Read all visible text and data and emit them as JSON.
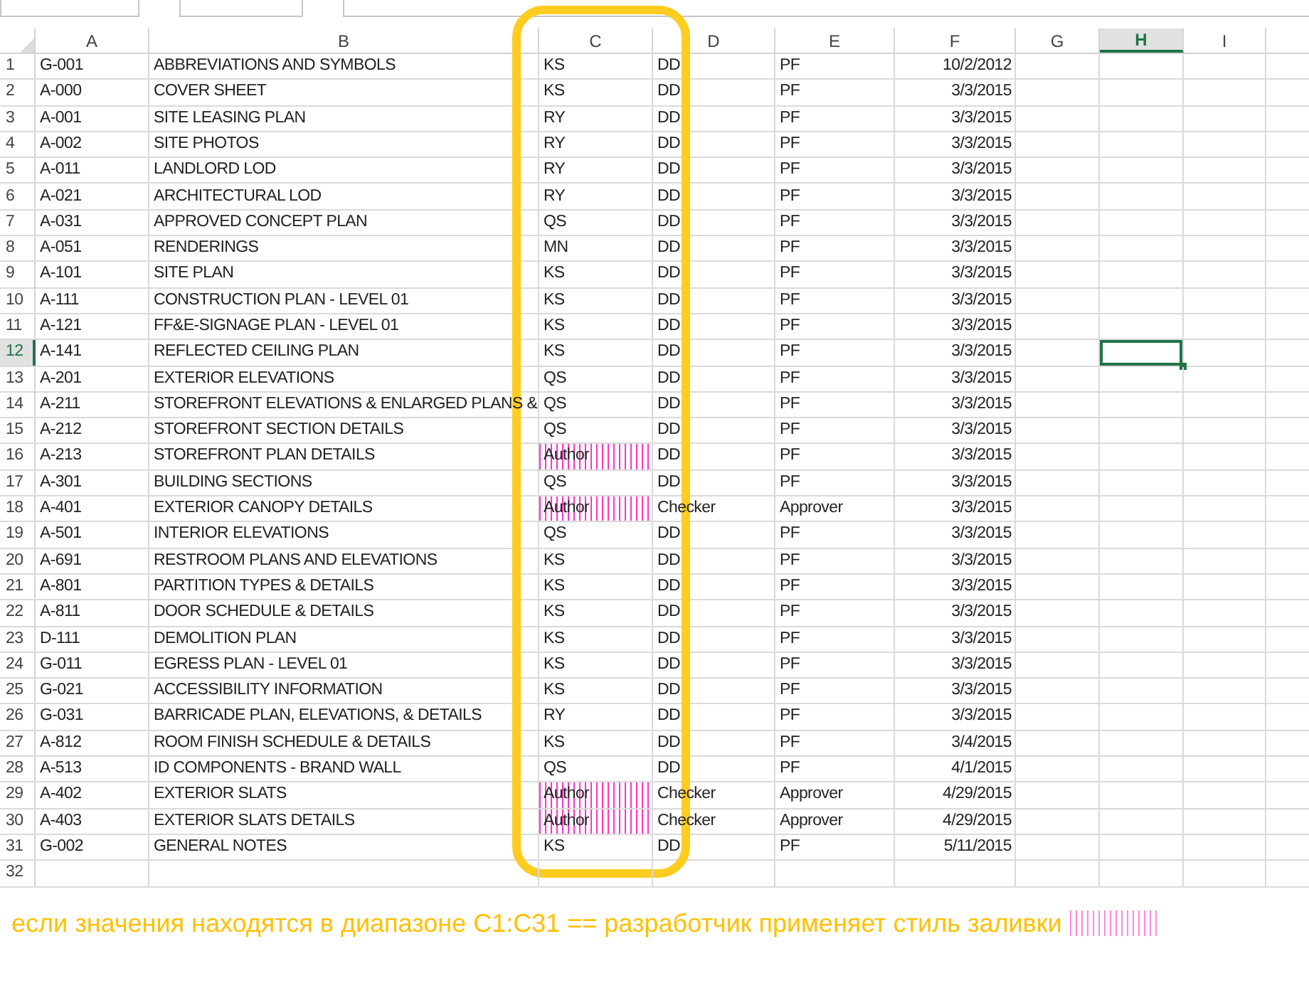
{
  "columns": [
    {
      "label": "A",
      "selected": false
    },
    {
      "label": "B",
      "selected": false
    },
    {
      "label": "C",
      "selected": false
    },
    {
      "label": "D",
      "selected": false
    },
    {
      "label": "E",
      "selected": false
    },
    {
      "label": "F",
      "selected": false
    },
    {
      "label": "G",
      "selected": false
    },
    {
      "label": "H",
      "selected": true
    },
    {
      "label": "I",
      "selected": false
    }
  ],
  "rows": [
    {
      "num": "1",
      "selected": false,
      "hatched": false,
      "cells": [
        "G-001",
        "ABBREVIATIONS AND SYMBOLS",
        "KS",
        "DD",
        "PF",
        "10/2/2012"
      ]
    },
    {
      "num": "2",
      "selected": false,
      "hatched": false,
      "cells": [
        "A-000",
        "COVER SHEET",
        "KS",
        "DD",
        "PF",
        "3/3/2015"
      ]
    },
    {
      "num": "3",
      "selected": false,
      "hatched": false,
      "cells": [
        "A-001",
        "SITE LEASING PLAN",
        "RY",
        "DD",
        "PF",
        "3/3/2015"
      ]
    },
    {
      "num": "4",
      "selected": false,
      "hatched": false,
      "cells": [
        "A-002",
        "SITE PHOTOS",
        "RY",
        "DD",
        "PF",
        "3/3/2015"
      ]
    },
    {
      "num": "5",
      "selected": false,
      "hatched": false,
      "cells": [
        "A-011",
        "LANDLORD LOD",
        "RY",
        "DD",
        "PF",
        "3/3/2015"
      ]
    },
    {
      "num": "6",
      "selected": false,
      "hatched": false,
      "cells": [
        "A-021",
        "ARCHITECTURAL LOD",
        "RY",
        "DD",
        "PF",
        "3/3/2015"
      ]
    },
    {
      "num": "7",
      "selected": false,
      "hatched": false,
      "cells": [
        "A-031",
        "APPROVED CONCEPT PLAN",
        "QS",
        "DD",
        "PF",
        "3/3/2015"
      ]
    },
    {
      "num": "8",
      "selected": false,
      "hatched": false,
      "cells": [
        "A-051",
        "RENDERINGS",
        "MN",
        "DD",
        "PF",
        "3/3/2015"
      ]
    },
    {
      "num": "9",
      "selected": false,
      "hatched": false,
      "cells": [
        "A-101",
        "SITE PLAN",
        "KS",
        "DD",
        "PF",
        "3/3/2015"
      ]
    },
    {
      "num": "10",
      "selected": false,
      "hatched": false,
      "cells": [
        "A-111",
        "CONSTRUCTION PLAN - LEVEL 01",
        "KS",
        "DD",
        "PF",
        "3/3/2015"
      ]
    },
    {
      "num": "11",
      "selected": false,
      "hatched": false,
      "cells": [
        "A-121",
        "FF&E-SIGNAGE PLAN - LEVEL 01",
        "KS",
        "DD",
        "PF",
        "3/3/2015"
      ]
    },
    {
      "num": "12",
      "selected": true,
      "hatched": false,
      "cells": [
        "A-141",
        "REFLECTED CEILING PLAN",
        "KS",
        "DD",
        "PF",
        "3/3/2015"
      ]
    },
    {
      "num": "13",
      "selected": false,
      "hatched": false,
      "cells": [
        "A-201",
        "EXTERIOR ELEVATIONS",
        "QS",
        "DD",
        "PF",
        "3/3/2015"
      ]
    },
    {
      "num": "14",
      "selected": false,
      "hatched": false,
      "cells": [
        "A-211",
        "STOREFRONT ELEVATIONS & ENLARGED PLANS &",
        "QS",
        "DD",
        "PF",
        "3/3/2015"
      ]
    },
    {
      "num": "15",
      "selected": false,
      "hatched": false,
      "cells": [
        "A-212",
        "STOREFRONT SECTION DETAILS",
        "QS",
        "DD",
        "PF",
        "3/3/2015"
      ]
    },
    {
      "num": "16",
      "selected": false,
      "hatched": true,
      "cells": [
        "A-213",
        "STOREFRONT PLAN DETAILS",
        "Author",
        "DD",
        "PF",
        "3/3/2015"
      ]
    },
    {
      "num": "17",
      "selected": false,
      "hatched": false,
      "cells": [
        "A-301",
        "BUILDING SECTIONS",
        "QS",
        "DD",
        "PF",
        "3/3/2015"
      ]
    },
    {
      "num": "18",
      "selected": false,
      "hatched": true,
      "cells": [
        "A-401",
        "EXTERIOR CANOPY DETAILS",
        "Author",
        "Checker",
        "Approver",
        "3/3/2015"
      ]
    },
    {
      "num": "19",
      "selected": false,
      "hatched": false,
      "cells": [
        "A-501",
        "INTERIOR ELEVATIONS",
        "QS",
        "DD",
        "PF",
        "3/3/2015"
      ]
    },
    {
      "num": "20",
      "selected": false,
      "hatched": false,
      "cells": [
        "A-691",
        "RESTROOM PLANS AND ELEVATIONS",
        "KS",
        "DD",
        "PF",
        "3/3/2015"
      ]
    },
    {
      "num": "21",
      "selected": false,
      "hatched": false,
      "cells": [
        "A-801",
        "PARTITION TYPES & DETAILS",
        "KS",
        "DD",
        "PF",
        "3/3/2015"
      ]
    },
    {
      "num": "22",
      "selected": false,
      "hatched": false,
      "cells": [
        "A-811",
        "DOOR SCHEDULE & DETAILS",
        "KS",
        "DD",
        "PF",
        "3/3/2015"
      ]
    },
    {
      "num": "23",
      "selected": false,
      "hatched": false,
      "cells": [
        "D-111",
        "DEMOLITION PLAN",
        "KS",
        "DD",
        "PF",
        "3/3/2015"
      ]
    },
    {
      "num": "24",
      "selected": false,
      "hatched": false,
      "cells": [
        "G-011",
        "EGRESS PLAN - LEVEL 01",
        "KS",
        "DD",
        "PF",
        "3/3/2015"
      ]
    },
    {
      "num": "25",
      "selected": false,
      "hatched": false,
      "cells": [
        "G-021",
        "ACCESSIBILITY INFORMATION",
        "KS",
        "DD",
        "PF",
        "3/3/2015"
      ]
    },
    {
      "num": "26",
      "selected": false,
      "hatched": false,
      "cells": [
        "G-031",
        "BARRICADE PLAN, ELEVATIONS, & DETAILS",
        "RY",
        "DD",
        "PF",
        "3/3/2015"
      ]
    },
    {
      "num": "27",
      "selected": false,
      "hatched": false,
      "cells": [
        "A-812",
        "ROOM FINISH SCHEDULE & DETAILS",
        "KS",
        "DD",
        "PF",
        "3/4/2015"
      ]
    },
    {
      "num": "28",
      "selected": false,
      "hatched": false,
      "cells": [
        "A-513",
        "ID COMPONENTS - BRAND WALL",
        "QS",
        "DD",
        "PF",
        "4/1/2015"
      ]
    },
    {
      "num": "29",
      "selected": false,
      "hatched": true,
      "cells": [
        "A-402",
        "EXTERIOR SLATS",
        "Author",
        "Checker",
        "Approver",
        "4/29/2015"
      ]
    },
    {
      "num": "30",
      "selected": false,
      "hatched": true,
      "cells": [
        "A-403",
        "EXTERIOR SLATS DETAILS",
        "Author",
        "Checker",
        "Approver",
        "4/29/2015"
      ]
    },
    {
      "num": "31",
      "selected": false,
      "hatched": false,
      "cells": [
        "G-002",
        "GENERAL NOTES",
        "KS",
        "DD",
        "PF",
        "5/11/2015"
      ]
    },
    {
      "num": "32",
      "selected": false,
      "hatched": false
    }
  ],
  "annotation": "если значения находятся в диапазоне C1:C31 == разработчик применяет стиль заливки"
}
